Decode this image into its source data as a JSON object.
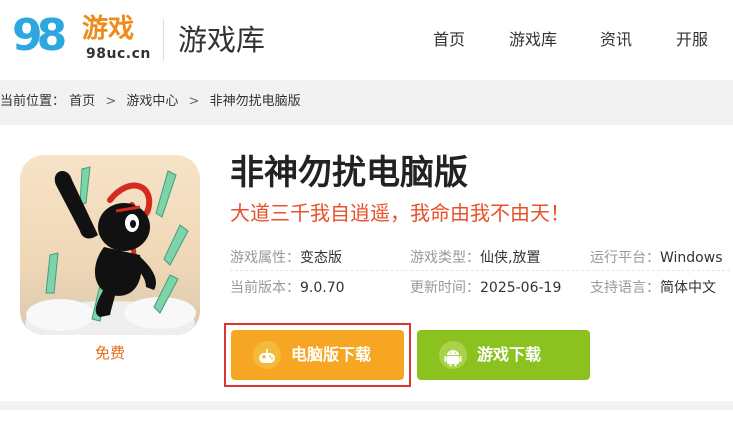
{
  "header": {
    "logo_digits": "98",
    "logo_brand": "游戏",
    "logo_domain": "98uc.cn",
    "section_title": "游戏库",
    "nav": [
      "首页",
      "游戏库",
      "资讯",
      "开服"
    ]
  },
  "breadcrumb": {
    "prefix": "当前位置：",
    "items": [
      "首页",
      "游戏中心",
      "非神勿扰电脑版"
    ],
    "separator": ">"
  },
  "game": {
    "title": "非神勿扰电脑版",
    "slogan": "大道三千我自逍遥，我命由我不由天！",
    "price_tag": "免费",
    "meta": {
      "attr_label": "游戏属性：",
      "attr_value": "变态版",
      "type_label": "游戏类型：",
      "type_value": "仙侠,放置",
      "platform_label": "运行平台：",
      "platform_value": "Windows",
      "version_label": "当前版本：",
      "version_value": "9.0.70",
      "updated_label": "更新时间：",
      "updated_value": "2025-06-19",
      "lang_label": "支持语言：",
      "lang_value": "简体中文"
    }
  },
  "buttons": {
    "pc_download": "电脑版下载",
    "game_download": "游戏下载",
    "pc_icon": "gamepad-icon",
    "game_icon": "android-icon"
  },
  "colors": {
    "accent_orange": "#f6a623",
    "accent_green": "#8cc21f",
    "slogan_red": "#e8502b",
    "highlight_red": "#d93636"
  }
}
